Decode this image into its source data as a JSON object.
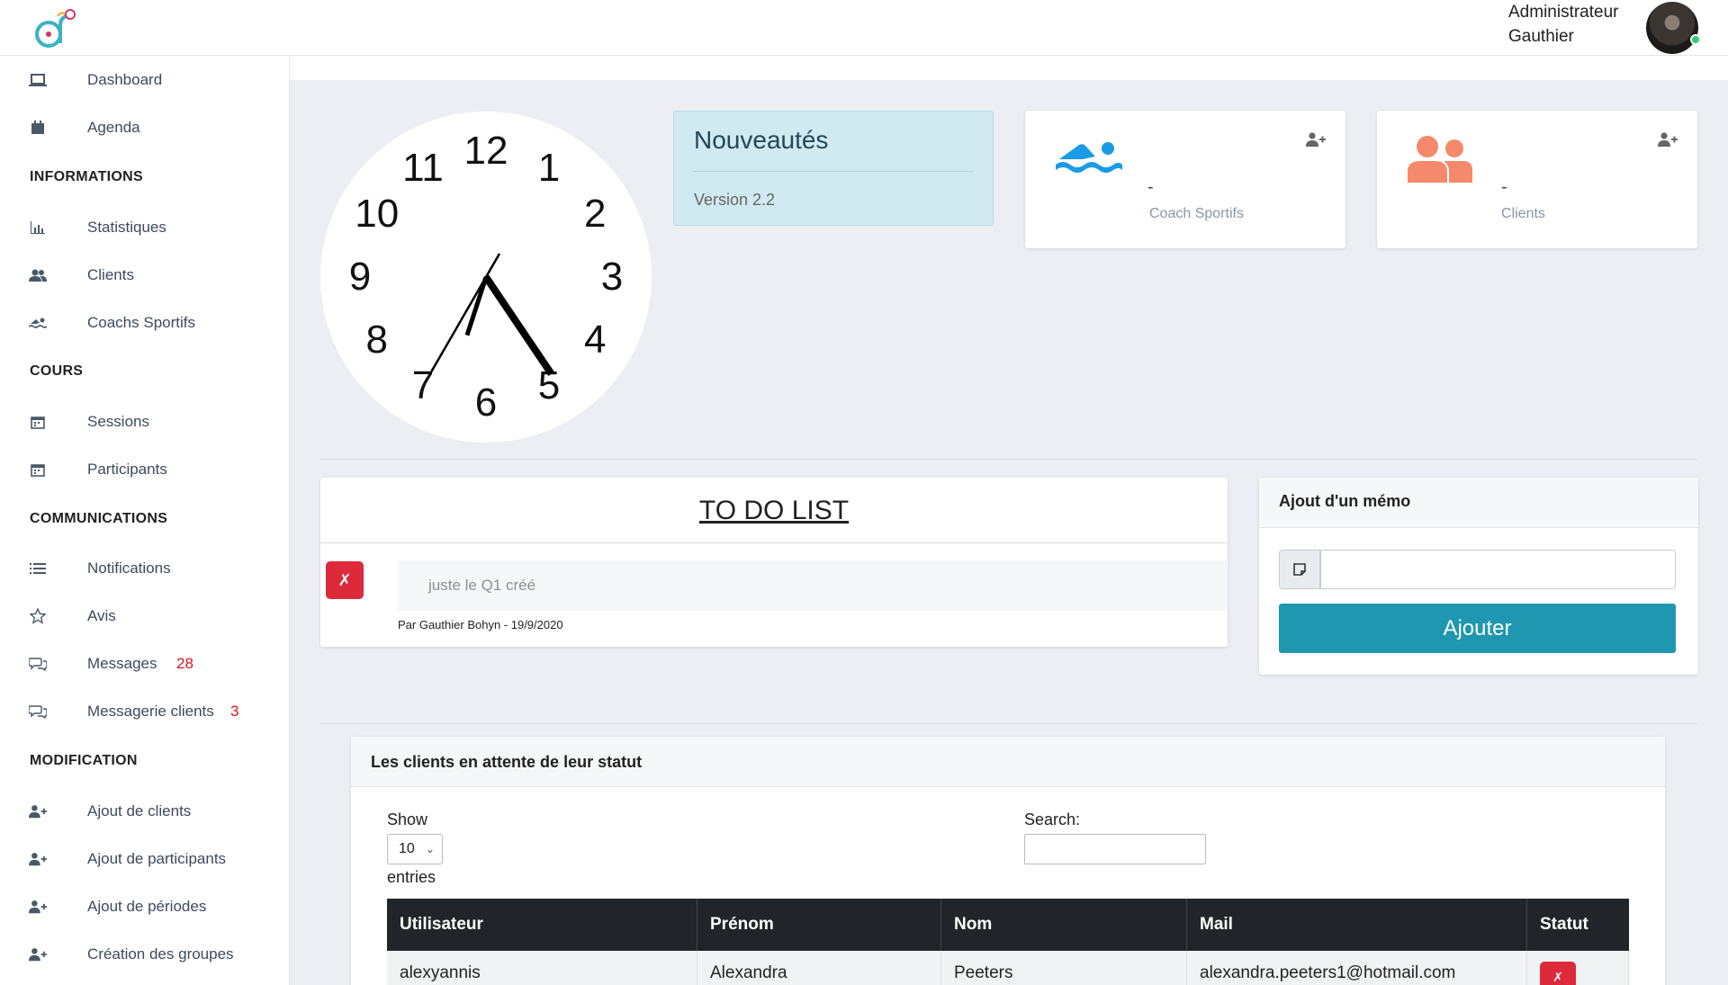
{
  "header": {
    "user_name": "Administrateur Gauthier",
    "user_line1": "Administrateur",
    "user_line2": "Gauthier"
  },
  "sidebar": {
    "items": [
      {
        "label": "Dashboard",
        "icon": "laptop-icon"
      },
      {
        "label": "Agenda",
        "icon": "calendar-icon"
      },
      {
        "label": "Statistiques",
        "icon": "bar-chart-icon"
      },
      {
        "label": "Clients",
        "icon": "users-icon"
      },
      {
        "label": "Coachs Sportifs",
        "icon": "swimmer-icon"
      },
      {
        "label": "Sessions",
        "icon": "calendar-icon"
      },
      {
        "label": "Participants",
        "icon": "calendar-icon"
      },
      {
        "label": "Notifications",
        "icon": "list-icon"
      },
      {
        "label": "Avis",
        "icon": "star-icon"
      },
      {
        "label": "Messages",
        "icon": "chat-icon",
        "badge": "28"
      },
      {
        "label": "Messagerie clients",
        "icon": "chat-icon",
        "badge": "3"
      },
      {
        "label": "Ajout de clients",
        "icon": "user-plus-icon"
      },
      {
        "label": "Ajout de participants",
        "icon": "user-plus-icon"
      },
      {
        "label": "Ajout de périodes",
        "icon": "user-plus-icon"
      },
      {
        "label": "Création des groupes",
        "icon": "user-plus-icon"
      }
    ],
    "sections": [
      "INFORMATIONS",
      "COURS",
      "COMMUNICATIONS",
      "MODIFICATION"
    ]
  },
  "clock": {
    "numbers": [
      "12",
      "1",
      "2",
      "3",
      "4",
      "5",
      "6",
      "7",
      "8",
      "9",
      "10",
      "11"
    ],
    "time": {
      "hour": 4,
      "minute": 27,
      "second": 35
    }
  },
  "news": {
    "title": "Nouveautés",
    "version": "Version 2.2"
  },
  "stats": [
    {
      "value": "-",
      "label": "Coach Sportifs",
      "icon": "swimmer-icon",
      "color": "#1a9be6"
    },
    {
      "value": "-",
      "label": "Clients",
      "icon": "users-icon",
      "color": "#f4896b"
    }
  ],
  "todo": {
    "title": "TO DO LIST",
    "delete_glyph": "✗",
    "item_text": "juste le Q1 créé",
    "item_author": "Par Gauthier Bohyn - 19/9/2020"
  },
  "memo": {
    "title": "Ajout d'un mémo",
    "input_value": "",
    "button_label": "Ajouter"
  },
  "pending": {
    "title": "Les clients en attente de leur statut",
    "show_label": "Show",
    "entries_value": "10",
    "entries_label": "entries",
    "search_label": "Search:",
    "search_value": "",
    "columns": [
      "Utilisateur",
      "Prénom",
      "Nom",
      "Mail",
      "Statut"
    ],
    "rows": [
      {
        "utilisateur": "alexyannis",
        "prenom": "Alexandra",
        "nom": "Peeters",
        "mail": "alexandra.peeters1@hotmail.com",
        "statut_glyph": "✗"
      }
    ]
  },
  "colors": {
    "accent": "#1f97b0",
    "danger": "#dc2a3b",
    "badge": "#e0121a",
    "coach_icon": "#1a9be6",
    "clients_icon": "#f4896b"
  }
}
